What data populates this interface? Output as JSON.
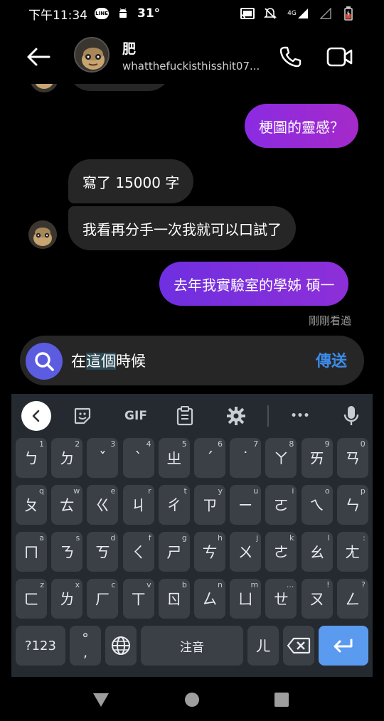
{
  "status_bar": {
    "time": "下午11:34",
    "line_label": "LINE",
    "temperature": "31°",
    "network": "4G"
  },
  "header": {
    "name": "肥",
    "handle": "whatthefuckisthisshit07..."
  },
  "messages": [
    {
      "direction": "out",
      "text": "梗圖的靈感？"
    },
    {
      "direction": "in",
      "text": "寫了 15000 字"
    },
    {
      "direction": "in",
      "text": "我看再分手一次我就可以口試了"
    },
    {
      "direction": "out",
      "text": "去年我實驗室的學姊 碩一"
    }
  ],
  "seen_label": "剛剛看過",
  "composer": {
    "text_before": "在",
    "text_composing": "這個",
    "text_after": "時候",
    "send_label": "傳送"
  },
  "keyboard": {
    "toolbar": {
      "gif_label": "GIF",
      "more_label": "•••"
    },
    "rows": [
      [
        {
          "k": "ㄅ",
          "h": "1"
        },
        {
          "k": "ㄉ",
          "h": "2"
        },
        {
          "k": "ˇ",
          "h": "3"
        },
        {
          "k": "ˋ",
          "h": "4"
        },
        {
          "k": "ㄓ",
          "h": "5"
        },
        {
          "k": "ˊ",
          "h": "6"
        },
        {
          "k": "˙",
          "h": "7"
        },
        {
          "k": "ㄚ",
          "h": "8"
        },
        {
          "k": "ㄞ",
          "h": "9"
        },
        {
          "k": "ㄢ",
          "h": "0"
        }
      ],
      [
        {
          "k": "ㄆ",
          "h": "q"
        },
        {
          "k": "ㄊ",
          "h": "w"
        },
        {
          "k": "ㄍ",
          "h": "e"
        },
        {
          "k": "ㄐ",
          "h": "r"
        },
        {
          "k": "ㄔ",
          "h": "t"
        },
        {
          "k": "ㄗ",
          "h": "y"
        },
        {
          "k": "ㄧ",
          "h": "u"
        },
        {
          "k": "ㄛ",
          "h": "i"
        },
        {
          "k": "ㄟ",
          "h": "o"
        },
        {
          "k": "ㄣ",
          "h": "p"
        }
      ],
      [
        {
          "k": "ㄇ",
          "h": "a"
        },
        {
          "k": "ㄋ",
          "h": "s"
        },
        {
          "k": "ㄎ",
          "h": "d"
        },
        {
          "k": "ㄑ",
          "h": "f"
        },
        {
          "k": "ㄕ",
          "h": "g"
        },
        {
          "k": "ㄘ",
          "h": "h"
        },
        {
          "k": "ㄨ",
          "h": "j"
        },
        {
          "k": "ㄜ",
          "h": "k"
        },
        {
          "k": "ㄠ",
          "h": "l"
        },
        {
          "k": "ㄤ",
          "h": ":"
        }
      ],
      [
        {
          "k": "ㄈ",
          "h": "z"
        },
        {
          "k": "ㄌ",
          "h": "x"
        },
        {
          "k": "ㄏ",
          "h": "c"
        },
        {
          "k": "ㄒ",
          "h": "v"
        },
        {
          "k": "ㄖ",
          "h": "b"
        },
        {
          "k": "ㄙ",
          "h": "n"
        },
        {
          "k": "ㄩ",
          "h": "m"
        },
        {
          "k": "ㄝ",
          "h": "..."
        },
        {
          "k": "ㄡ",
          "h": "!"
        },
        {
          "k": "ㄥ",
          "h": "?"
        }
      ]
    ],
    "bottom": {
      "symbols_label": "?123",
      "punct_top": "°",
      "punct_bottom": ",",
      "space_label": "注音",
      "er_label": "ㄦ"
    }
  },
  "colors": {
    "outgoing_gradient_start": "#8a2be2",
    "outgoing_gradient_end": "#a52ac9",
    "incoming_bg": "#262626",
    "send_blue": "#3d8be8",
    "enter_key": "#5a9bf0"
  }
}
